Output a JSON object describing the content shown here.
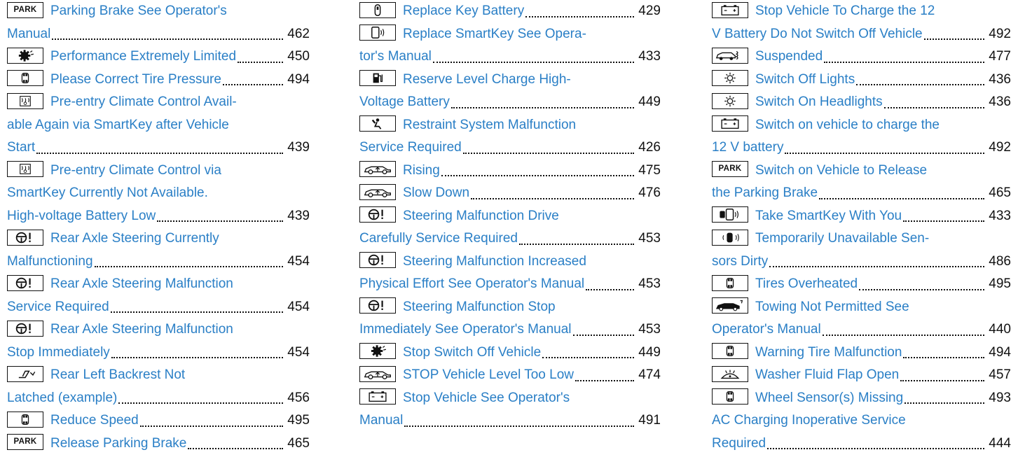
{
  "columns": [
    {
      "entries": [
        {
          "icon": "park-icon",
          "lines": [
            "Parking Brake See Operator's",
            "Manual"
          ],
          "page": "462"
        },
        {
          "icon": "engine-gear-icon",
          "lines": [
            "Performance Extremely Limited"
          ],
          "page": "450"
        },
        {
          "icon": "tire-pressure-icon",
          "lines": [
            "Please Correct Tire Pressure"
          ],
          "page": "494"
        },
        {
          "icon": "climate-control-icon",
          "lines": [
            "Pre-entry Climate Control Avail-",
            "able Again via SmartKey after Vehicle",
            "Start"
          ],
          "page": "439"
        },
        {
          "icon": "climate-control-icon",
          "lines": [
            "Pre-entry Climate Control via",
            "SmartKey Currently Not Available.",
            "High-voltage Battery Low"
          ],
          "page": "439"
        },
        {
          "icon": "steering-warning-icon",
          "lines": [
            "Rear Axle Steering Currently",
            "Malfunctioning"
          ],
          "page": "454"
        },
        {
          "icon": "steering-warning-icon",
          "lines": [
            "Rear Axle Steering Malfunction",
            "Service Required"
          ],
          "page": "454"
        },
        {
          "icon": "steering-warning-icon",
          "lines": [
            "Rear Axle Steering Malfunction",
            "Stop Immediately"
          ],
          "page": "454"
        },
        {
          "icon": "backrest-icon",
          "lines": [
            "Rear Left Backrest Not",
            "Latched (example)"
          ],
          "page": "456"
        },
        {
          "icon": "tire-pressure-icon",
          "lines": [
            "Reduce Speed"
          ],
          "page": "495"
        },
        {
          "icon": "park-icon",
          "lines": [
            "Release Parking Brake"
          ],
          "page": "465"
        }
      ]
    },
    {
      "entries": [
        {
          "icon": "key-icon",
          "lines": [
            "Replace Key Battery"
          ],
          "page": "429"
        },
        {
          "icon": "smartkey-icon",
          "lines": [
            "Replace SmartKey See Opera-",
            "tor's Manual"
          ],
          "page": "433"
        },
        {
          "icon": "fuel-reserve-icon",
          "lines": [
            "Reserve Level Charge High-",
            "Voltage Battery"
          ],
          "page": "449"
        },
        {
          "icon": "airbag-icon",
          "lines": [
            "Restraint System Malfunction",
            "Service Required"
          ],
          "page": "426"
        },
        {
          "icon": "vehicle-level-icon",
          "lines": [
            "Rising"
          ],
          "page": "475"
        },
        {
          "icon": "vehicle-level-icon",
          "lines": [
            "Slow Down"
          ],
          "page": "476"
        },
        {
          "icon": "steering-warning-icon",
          "lines": [
            "Steering Malfunction Drive",
            "Carefully Service Required"
          ],
          "page": "453"
        },
        {
          "icon": "steering-warning-icon",
          "lines": [
            "Steering Malfunction Increased",
            "Physical Effort See Operator's Manual"
          ],
          "page": "453"
        },
        {
          "icon": "steering-warning-icon",
          "lines": [
            "Steering Malfunction Stop",
            "Immediately See Operator's Manual"
          ],
          "page": "453"
        },
        {
          "icon": "engine-gear-icon",
          "lines": [
            "Stop Switch Off Vehicle"
          ],
          "page": "449"
        },
        {
          "icon": "vehicle-level-icon",
          "lines": [
            "STOP Vehicle Level Too Low"
          ],
          "page": "474"
        },
        {
          "icon": "battery-icon",
          "lines": [
            "Stop Vehicle See Operator's",
            "Manual"
          ],
          "page": "491"
        }
      ]
    },
    {
      "entries": [
        {
          "icon": "battery-icon",
          "lines": [
            "Stop Vehicle To Charge the 12",
            "V Battery Do Not Switch Off Vehicle"
          ],
          "page": "492"
        },
        {
          "icon": "suspension-icon",
          "lines": [
            "Suspended"
          ],
          "page": "477"
        },
        {
          "icon": "light-icon",
          "lines": [
            "Switch Off Lights"
          ],
          "page": "436"
        },
        {
          "icon": "light-icon",
          "lines": [
            "Switch On Headlights"
          ],
          "page": "436"
        },
        {
          "icon": "battery-icon",
          "lines": [
            "Switch on vehicle to charge the",
            "12 V battery"
          ],
          "page": "492"
        },
        {
          "icon": "park-icon",
          "lines": [
            "Switch on Vehicle to Release",
            "the Parking Brake"
          ],
          "page": "465"
        },
        {
          "icon": "smartkey-take-icon",
          "lines": [
            "Take SmartKey With You"
          ],
          "page": "433"
        },
        {
          "icon": "sensor-icon",
          "lines": [
            "Temporarily Unavailable Sen-",
            "sors Dirty"
          ],
          "page": "486"
        },
        {
          "icon": "tire-pressure-icon",
          "lines": [
            "Tires Overheated"
          ],
          "page": "495"
        },
        {
          "icon": "towing-icon",
          "lines": [
            "Towing Not Permitted See",
            "Operator's Manual"
          ],
          "page": "440"
        },
        {
          "icon": "tire-pressure-icon",
          "lines": [
            "Warning Tire Malfunction"
          ],
          "page": "494"
        },
        {
          "icon": "washer-fluid-icon",
          "lines": [
            "Washer Fluid Flap Open"
          ],
          "page": "457"
        },
        {
          "icon": "tire-pressure-icon",
          "lines": [
            "Wheel Sensor(s) Missing"
          ],
          "page": "493"
        },
        {
          "icon": null,
          "lines": [
            "AC Charging Inoperative Service",
            "Required"
          ],
          "page": "444"
        }
      ]
    }
  ],
  "icon_labels": {
    "park": "PARK"
  },
  "colors": {
    "link": "#2a7fc6",
    "text": "#111111"
  }
}
